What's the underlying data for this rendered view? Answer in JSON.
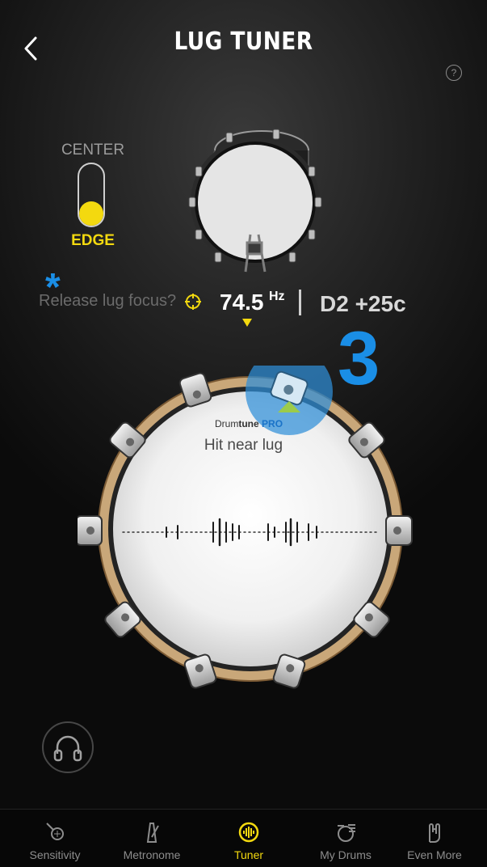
{
  "header": {
    "title": "LUG TUNER",
    "back_icon": "chevron-left-icon",
    "help_label": "?"
  },
  "focus_toggle": {
    "top_label": "CENTER",
    "bottom_label": "EDGE",
    "selected": "EDGE",
    "accent_color": "#f3d90f"
  },
  "readout": {
    "release_prompt": "Release lug focus?",
    "frequency": "74.5",
    "frequency_unit": "Hz",
    "note": "D2 +25c"
  },
  "annotations": {
    "asterisk": "*",
    "step_number": "3",
    "color": "#1a8ee6"
  },
  "drum": {
    "brand_prefix": "Drum",
    "brand_bold": "tune",
    "brand_pro": "PRO",
    "hint": "Hit near lug",
    "lug_count": 10
  },
  "tabs": [
    {
      "label": "Sensitivity",
      "icon": "microphone-icon",
      "active": false
    },
    {
      "label": "Metronome",
      "icon": "metronome-icon",
      "active": false
    },
    {
      "label": "Tuner",
      "icon": "tuner-icon",
      "active": true
    },
    {
      "label": "My Drums",
      "icon": "drum-kit-icon",
      "active": false
    },
    {
      "label": "Even More",
      "icon": "rock-hand-icon",
      "active": false
    }
  ]
}
